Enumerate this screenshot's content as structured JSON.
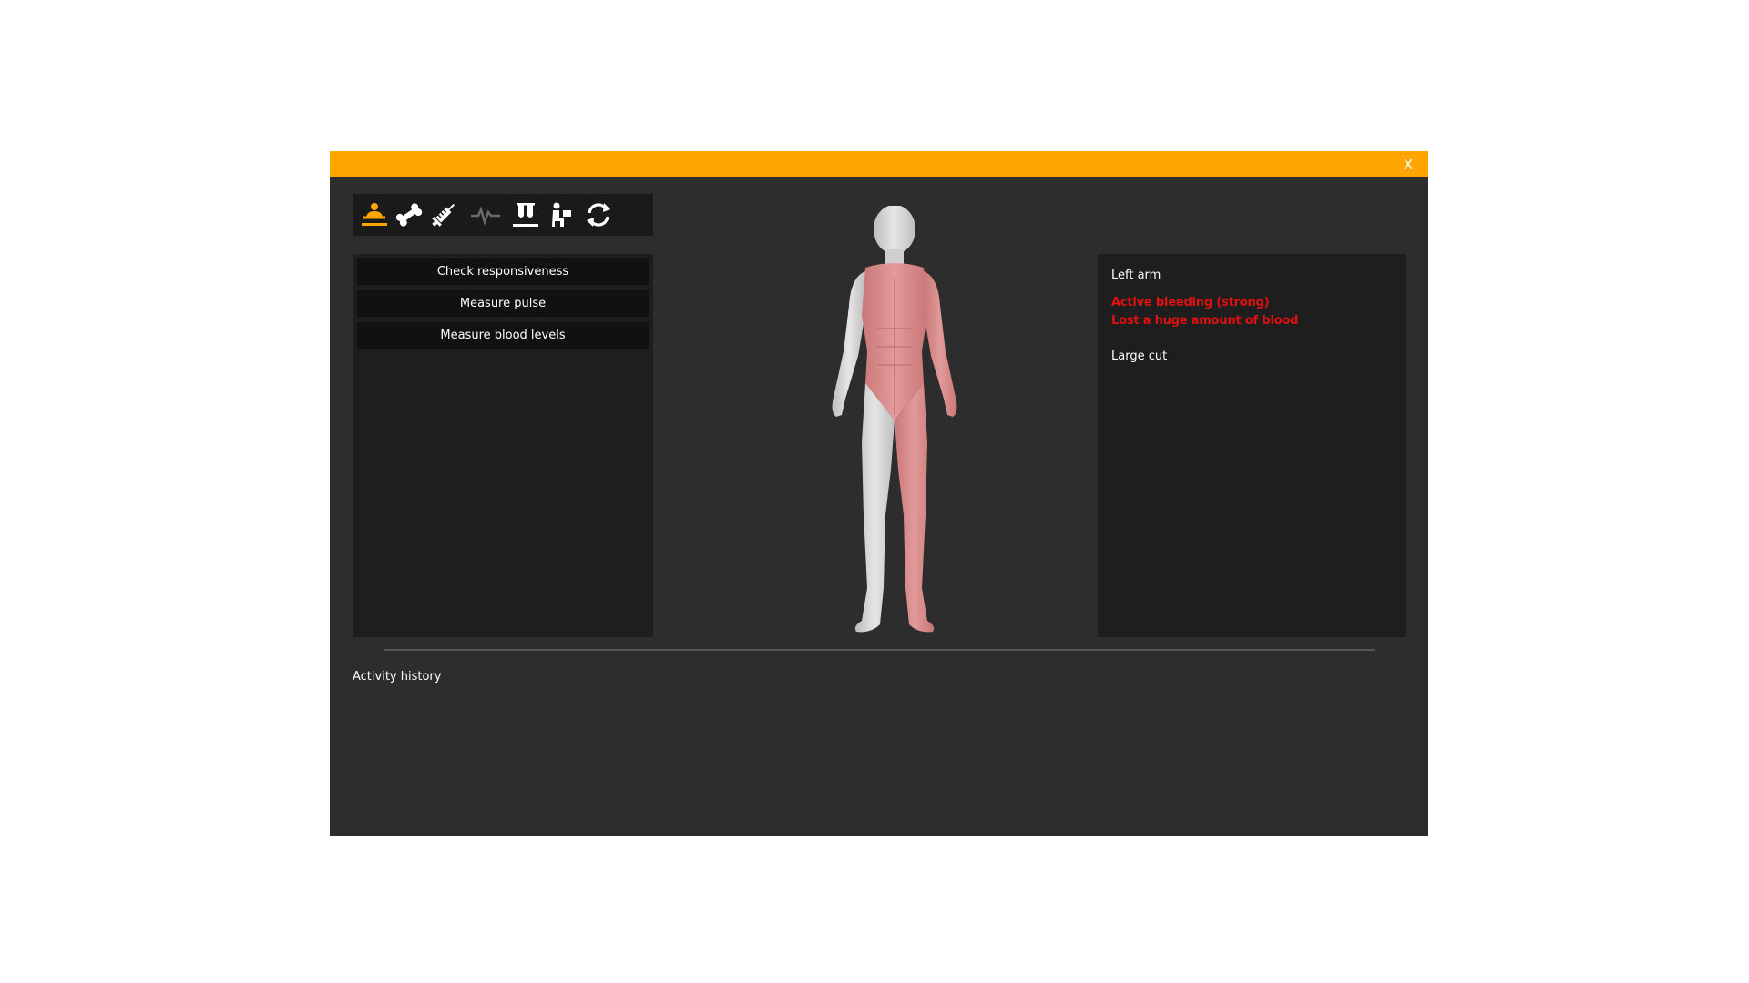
{
  "window": {
    "close_label": "X",
    "accent_color": "#ffa500"
  },
  "toolbar": {
    "tools": [
      {
        "name": "examine-patient-icon",
        "active": true
      },
      {
        "name": "bone-icon",
        "active": false
      },
      {
        "name": "syringe-icon",
        "active": false
      },
      {
        "name": "heartbeat-icon",
        "active": false,
        "disabled": true
      },
      {
        "name": "test-tubes-icon",
        "active": false
      },
      {
        "name": "person-sign-icon",
        "active": false
      },
      {
        "name": "refresh-icon",
        "active": false
      }
    ]
  },
  "actions": [
    {
      "label": "Check responsiveness"
    },
    {
      "label": "Measure pulse"
    },
    {
      "label": "Measure blood levels"
    }
  ],
  "info": {
    "title": "Left arm",
    "status_lines": [
      "Active bleeding (strong)",
      "Lost a huge amount of blood"
    ],
    "injury": "Large cut"
  },
  "history": {
    "label": "Activity history"
  },
  "body_model": {
    "highlight_color": "#d98a8a",
    "base_color": "#d9d9d9"
  }
}
